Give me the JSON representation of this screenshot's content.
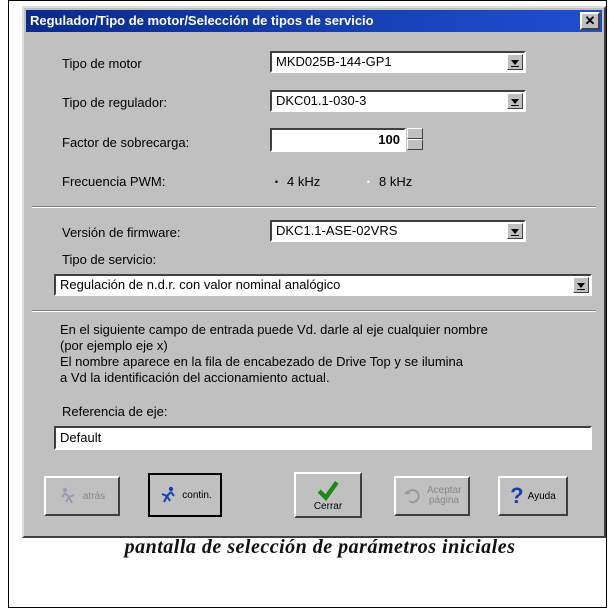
{
  "window": {
    "title": "Regulador/Tipo de motor/Selección de tipos de servicio",
    "close_label": "✕"
  },
  "motor": {
    "label": "Tipo de motor",
    "value": "MKD025B-144-GP1"
  },
  "regulator": {
    "label": "Tipo de regulador:",
    "value": "DKC01.1-030-3"
  },
  "overload": {
    "label": "Factor de sobrecarga:",
    "value": "100"
  },
  "pwm": {
    "label": "Frecuencia PWM:",
    "option1": "4 kHz",
    "option2": "8 kHz",
    "selected": "4 kHz"
  },
  "firmware": {
    "label": "Versión de firmware:",
    "value": "DKC1.1-ASE-02VRS"
  },
  "service": {
    "label": "Tipo de servicio:",
    "value": "Regulación de n.d.r. con valor nominal analógico"
  },
  "info": {
    "line1": "En el siguiente campo de entrada puede Vd. darle al eje cualquier nombre",
    "line2": "(por ejemplo eje x)",
    "line3": "El nombre aparece en la fila de encabezado de Drive Top y se ilumina",
    "line4": "a Vd la identificación del accionamiento actual."
  },
  "axis_ref": {
    "label": "Referencia de eje:",
    "value": "Default"
  },
  "buttons": {
    "back": "atrás",
    "next": "contin.",
    "close": "Cerrar",
    "apply": "Aceptar página",
    "help": "Ayuda"
  },
  "caption": "pantalla de selección de parámetros iniciales",
  "colors": {
    "titlebar": "#0a2a8c",
    "dialog_bg": "#c0c0c0"
  }
}
